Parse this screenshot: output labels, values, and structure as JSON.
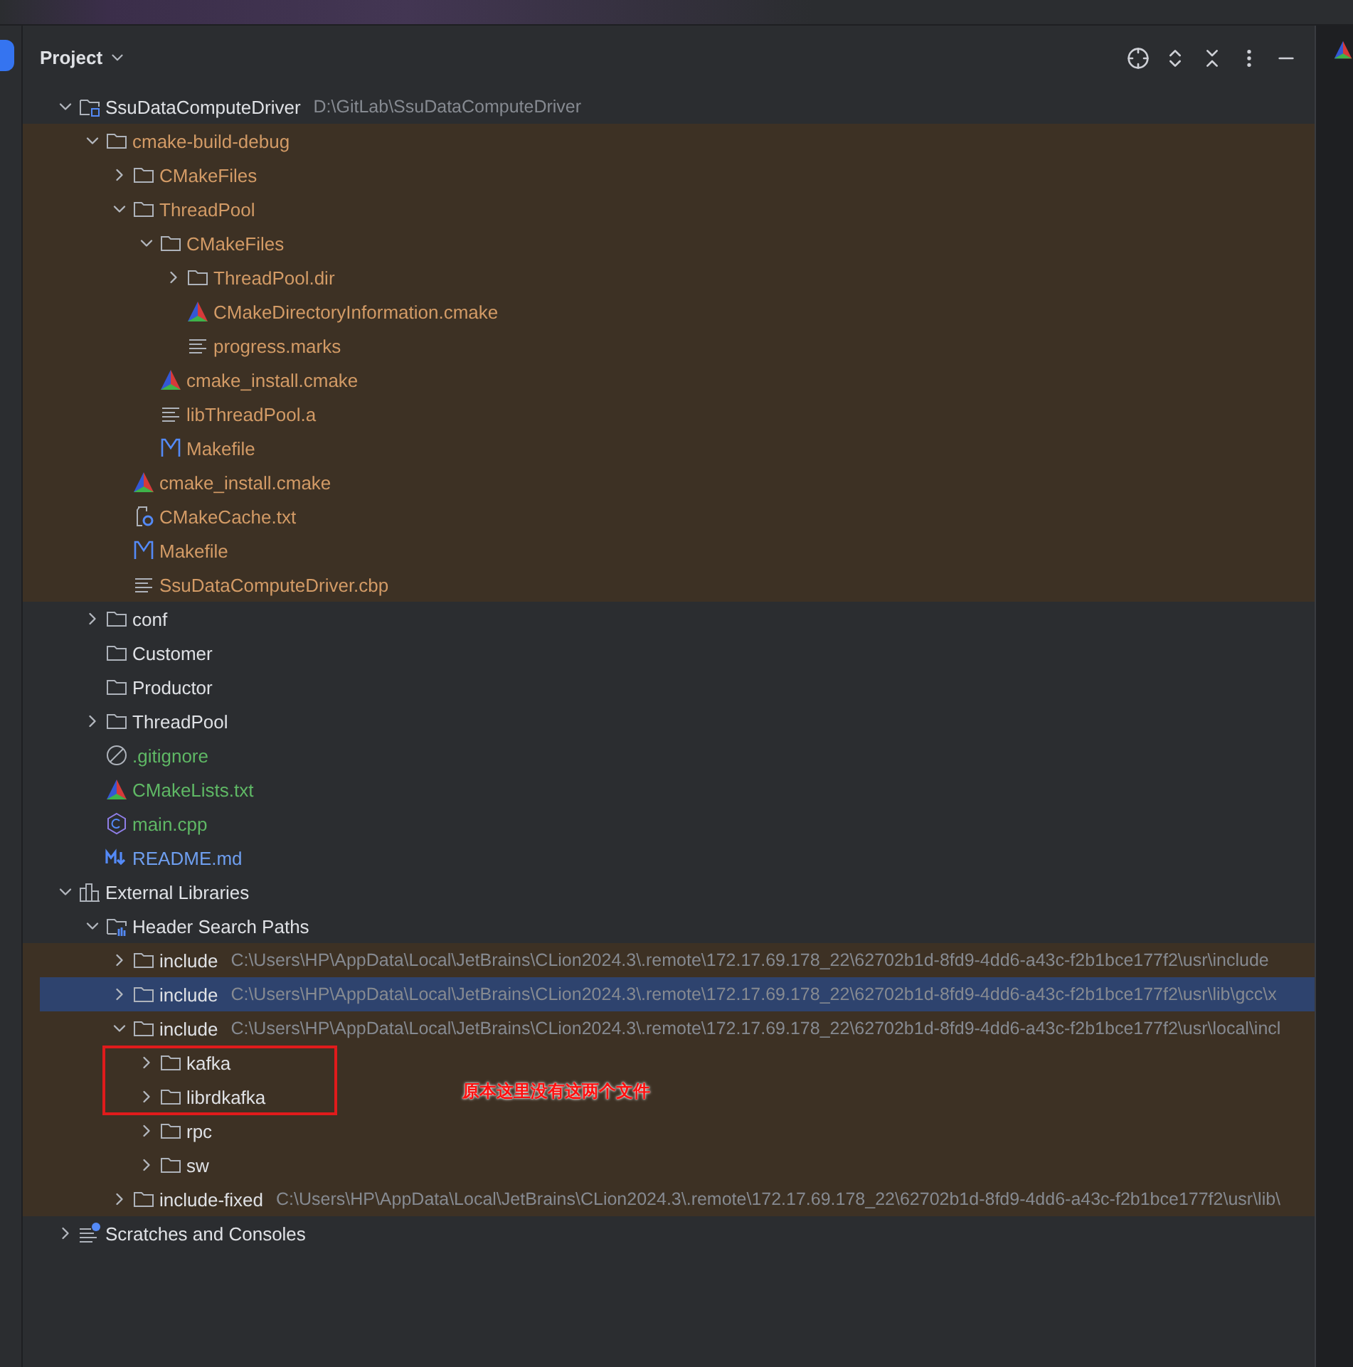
{
  "panel": {
    "title": "Project"
  },
  "tree": [
    {
      "label": "SsuDataComputeDriver",
      "kind": "module",
      "path": "D:\\GitLab\\SsuDataComputeDriver",
      "color": "#dfe1e5",
      "non_project": false,
      "selected": false,
      "expanded": true,
      "children": [
        {
          "label": "cmake-build-debug",
          "kind": "folder",
          "color": "#d39b66",
          "non_project": true,
          "selected": false,
          "expanded": true,
          "children": [
            {
              "label": "CMakeFiles",
              "kind": "folder",
              "color": "#d39b66",
              "non_project": true,
              "selected": false,
              "expanded": false
            },
            {
              "label": "ThreadPool",
              "kind": "folder",
              "color": "#d39b66",
              "non_project": true,
              "selected": false,
              "expanded": true,
              "children": [
                {
                  "label": "CMakeFiles",
                  "kind": "folder",
                  "color": "#d39b66",
                  "non_project": true,
                  "selected": false,
                  "expanded": true,
                  "children": [
                    {
                      "label": "ThreadPool.dir",
                      "kind": "folder",
                      "color": "#d39b66",
                      "non_project": true,
                      "selected": false,
                      "expanded": false
                    },
                    {
                      "label": "CMakeDirectoryInformation.cmake",
                      "kind": "cmake",
                      "color": "#d39b66",
                      "non_project": true,
                      "selected": false
                    },
                    {
                      "label": "progress.marks",
                      "kind": "text",
                      "color": "#d39b66",
                      "non_project": true,
                      "selected": false
                    }
                  ]
                },
                {
                  "label": "cmake_install.cmake",
                  "kind": "cmake",
                  "color": "#d39b66",
                  "non_project": true,
                  "selected": false
                },
                {
                  "label": "libThreadPool.a",
                  "kind": "text",
                  "color": "#d39b66",
                  "non_project": true,
                  "selected": false
                },
                {
                  "label": "Makefile",
                  "kind": "makefile",
                  "color": "#d39b66",
                  "non_project": true,
                  "selected": false
                }
              ]
            },
            {
              "label": "cmake_install.cmake",
              "kind": "cmake",
              "color": "#d39b66",
              "non_project": true,
              "selected": false
            },
            {
              "label": "CMakeCache.txt",
              "kind": "cache",
              "color": "#d39b66",
              "non_project": true,
              "selected": false
            },
            {
              "label": "Makefile",
              "kind": "makefile",
              "color": "#d39b66",
              "non_project": true,
              "selected": false
            },
            {
              "label": "SsuDataComputeDriver.cbp",
              "kind": "text",
              "color": "#d39b66",
              "non_project": true,
              "selected": false
            }
          ]
        },
        {
          "label": "conf",
          "kind": "folder",
          "color": "#dfe1e5",
          "non_project": false,
          "selected": false,
          "expanded": false
        },
        {
          "label": "Customer",
          "kind": "folder",
          "color": "#dfe1e5",
          "non_project": false,
          "selected": false
        },
        {
          "label": "Productor",
          "kind": "folder",
          "color": "#dfe1e5",
          "non_project": false,
          "selected": false
        },
        {
          "label": "ThreadPool",
          "kind": "folder",
          "color": "#dfe1e5",
          "non_project": false,
          "selected": false,
          "expanded": false
        },
        {
          "label": ".gitignore",
          "kind": "ignore",
          "color": "#5fb865",
          "non_project": false,
          "selected": false
        },
        {
          "label": "CMakeLists.txt",
          "kind": "cmakelists",
          "color": "#5fb865",
          "non_project": false,
          "selected": false
        },
        {
          "label": "main.cpp",
          "kind": "cpp",
          "color": "#5fb865",
          "non_project": false,
          "selected": false
        },
        {
          "label": "README.md",
          "kind": "markdown",
          "color": "#6f9ff0",
          "non_project": false,
          "selected": false
        }
      ]
    },
    {
      "label": "External Libraries",
      "kind": "library",
      "color": "#dfe1e5",
      "non_project": false,
      "selected": false,
      "expanded": true,
      "children": [
        {
          "label": "Header Search Paths",
          "kind": "headers",
          "color": "#dfe1e5",
          "non_project": false,
          "selected": false,
          "expanded": true,
          "children": [
            {
              "label": "include",
              "kind": "folder",
              "path": "C:\\Users\\HP\\AppData\\Local\\JetBrains\\CLion2024.3\\.remote\\172.17.69.178_22\\62702b1d-8fd9-4dd6-a43c-f2b1bce177f2\\usr\\include",
              "color": "#dfe1e5",
              "non_project": true,
              "selected": false,
              "expanded": false
            },
            {
              "label": "include",
              "kind": "folder",
              "path": "C:\\Users\\HP\\AppData\\Local\\JetBrains\\CLion2024.3\\.remote\\172.17.69.178_22\\62702b1d-8fd9-4dd6-a43c-f2b1bce177f2\\usr\\lib\\gcc\\x",
              "color": "#dfe1e5",
              "non_project": true,
              "selected": true,
              "expanded": false
            },
            {
              "label": "include",
              "kind": "folder",
              "path": "C:\\Users\\HP\\AppData\\Local\\JetBrains\\CLion2024.3\\.remote\\172.17.69.178_22\\62702b1d-8fd9-4dd6-a43c-f2b1bce177f2\\usr\\local\\incl",
              "color": "#dfe1e5",
              "non_project": true,
              "selected": false,
              "expanded": true,
              "children": [
                {
                  "label": "kafka",
                  "kind": "folder",
                  "color": "#dfe1e5",
                  "non_project": true,
                  "selected": false,
                  "expanded": false
                },
                {
                  "label": "librdkafka",
                  "kind": "folder",
                  "color": "#dfe1e5",
                  "non_project": true,
                  "selected": false,
                  "expanded": false
                },
                {
                  "label": "rpc",
                  "kind": "folder",
                  "color": "#dfe1e5",
                  "non_project": true,
                  "selected": false,
                  "expanded": false
                },
                {
                  "label": "sw",
                  "kind": "folder",
                  "color": "#dfe1e5",
                  "non_project": true,
                  "selected": false,
                  "expanded": false
                }
              ]
            },
            {
              "label": "include-fixed",
              "kind": "folder",
              "path": "C:\\Users\\HP\\AppData\\Local\\JetBrains\\CLion2024.3\\.remote\\172.17.69.178_22\\62702b1d-8fd9-4dd6-a43c-f2b1bce177f2\\usr\\lib\\",
              "color": "#dfe1e5",
              "non_project": true,
              "selected": false,
              "expanded": false
            }
          ]
        }
      ]
    },
    {
      "label": "Scratches and Consoles",
      "kind": "scratches",
      "color": "#dfe1e5",
      "non_project": false,
      "selected": false,
      "expanded": false
    }
  ],
  "annotation": {
    "text": "原本这里没有这两个文件"
  }
}
